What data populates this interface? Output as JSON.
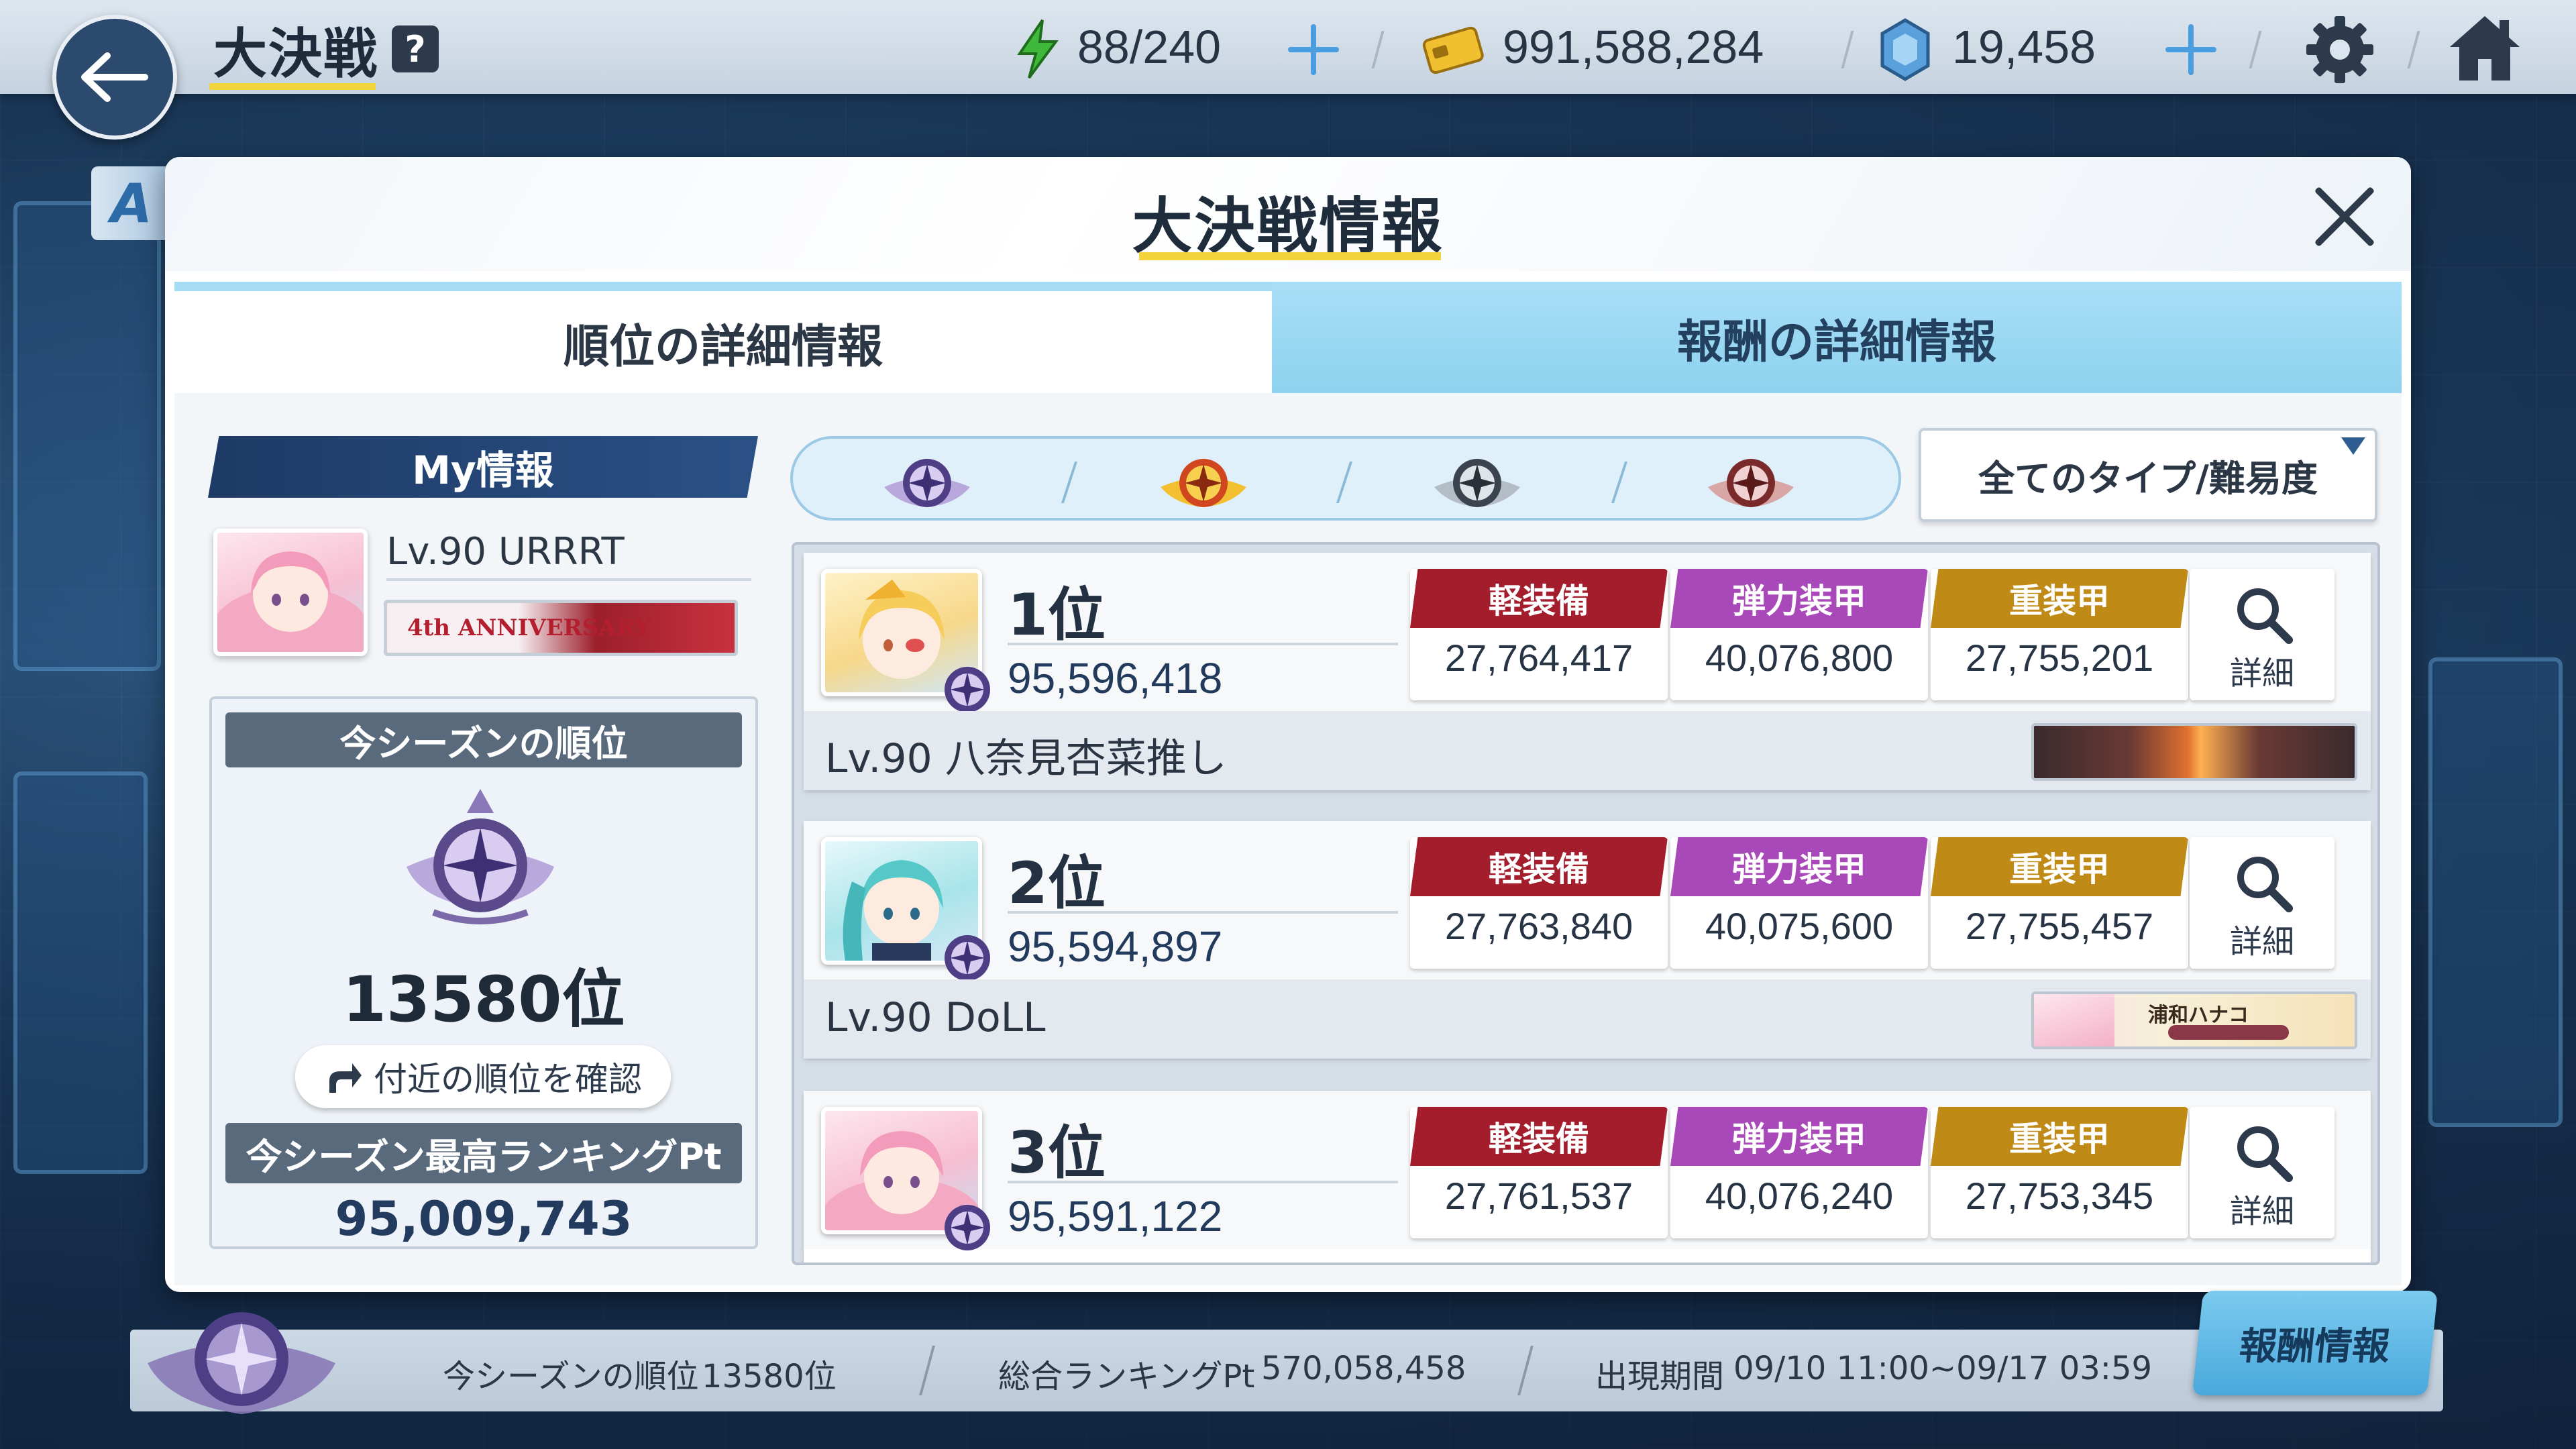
{
  "topbar": {
    "title": "大決戦",
    "help": "?",
    "ap": "88/240",
    "credits": "991,588,284",
    "gems": "19,458"
  },
  "modal": {
    "title": "大決戦情報",
    "tabs": [
      "順位の詳細情報",
      "報酬の詳細情報"
    ],
    "active_tab": 0
  },
  "my_info": {
    "header": "My情報",
    "level_name": "Lv.90 URRRT",
    "banner_text": "4th ANNIVERSARY",
    "season_rank_label": "今シーズンの順位",
    "season_rank": "13580位",
    "nearby_button": "付近の順位を確認",
    "best_pt_label": "今シーズン最高ランキングPt",
    "best_pt": "95,009,743"
  },
  "filters": {
    "difficulties": [
      "difficulty-purple",
      "difficulty-gold",
      "difficulty-silver",
      "difficulty-bronze"
    ],
    "selected_difficulty": 1,
    "type_filter": "全てのタイプ/難易度"
  },
  "categories": {
    "light": "軽装備",
    "elastic": "弾力装甲",
    "heavy": "重装甲"
  },
  "detail_label": "詳細",
  "rankings": [
    {
      "rank": "1位",
      "score": "95,596,418",
      "light": "27,764,417",
      "elastic": "40,076,800",
      "heavy": "27,755,201",
      "player": "Lv.90 八奈見杏菜推し",
      "banner": ""
    },
    {
      "rank": "2位",
      "score": "95,594,897",
      "light": "27,763,840",
      "elastic": "40,075,600",
      "heavy": "27,755,457",
      "player": "Lv.90 DoLL",
      "banner": "浦和ハナコ"
    },
    {
      "rank": "3位",
      "score": "95,591,122",
      "light": "27,761,537",
      "elastic": "40,076,240",
      "heavy": "27,753,345",
      "player": "",
      "banner": ""
    }
  ],
  "bottom": {
    "season_rank_label": "今シーズンの順位",
    "season_rank": "13580位",
    "total_pt_label": "総合ランキングPt",
    "total_pt": "570,058,458",
    "period_label": "出現期間",
    "period": "09/10 11:00~09/17 03:59",
    "reward_button": "報酬情報"
  },
  "side_tag": "A",
  "colors": {
    "light": "#a41d2c",
    "elastic": "#a948b8",
    "heavy": "#c08a17",
    "accent": "#f4d43c"
  }
}
